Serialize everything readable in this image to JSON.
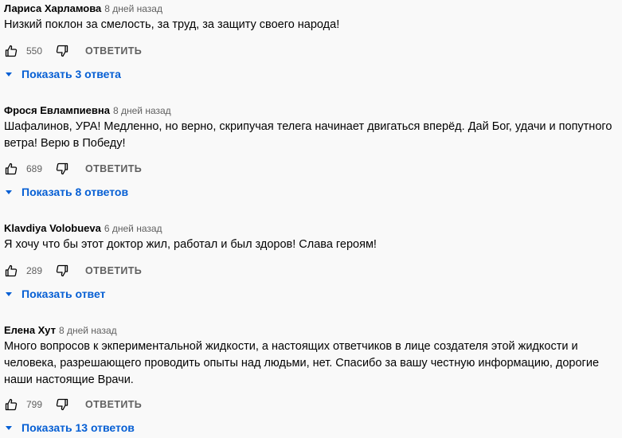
{
  "reply_button_label": "ОТВЕТИТЬ",
  "colors": {
    "link": "#065fd4",
    "meta": "#606060",
    "text": "#030303"
  },
  "icons": {
    "like": "thumbs-up-icon",
    "dislike": "thumbs-down-icon",
    "expand": "triangle-down-icon"
  },
  "comments": [
    {
      "author": "Лариса Харламова",
      "time": "8 дней назад",
      "text": "Низкий поклон за смелость, за труд, за защиту своего народа!",
      "likes": "550",
      "replies_label": "Показать 3 ответа"
    },
    {
      "author": "Фрося Евлампиевна",
      "time": "8 дней назад",
      "text": "Шафалинов, УРА! Медленно, но верно, скрипучая телега начинает двигаться вперёд. Дай Бог, удачи и попутного ветра! Верю в Победу!",
      "likes": "689",
      "replies_label": "Показать 8 ответов"
    },
    {
      "author": "Klavdiya Volobueva",
      "time": "6 дней назад",
      "text": "Я хочу что бы этот доктор жил, работал и был здоров! Слава героям!",
      "likes": "289",
      "replies_label": "Показать ответ"
    },
    {
      "author": "Елена Хут",
      "time": "8 дней назад",
      "text": "Много вопросов к экпериментальной жидкости, а настоящих ответчиков в лице создателя этой жидкости и человека, разрешающего проводить опыты над людьми, нет. Спасибо за вашу честную информацию, дорогие наши настоящие  Врачи.",
      "likes": "799",
      "replies_label": "Показать 13 ответов"
    }
  ]
}
